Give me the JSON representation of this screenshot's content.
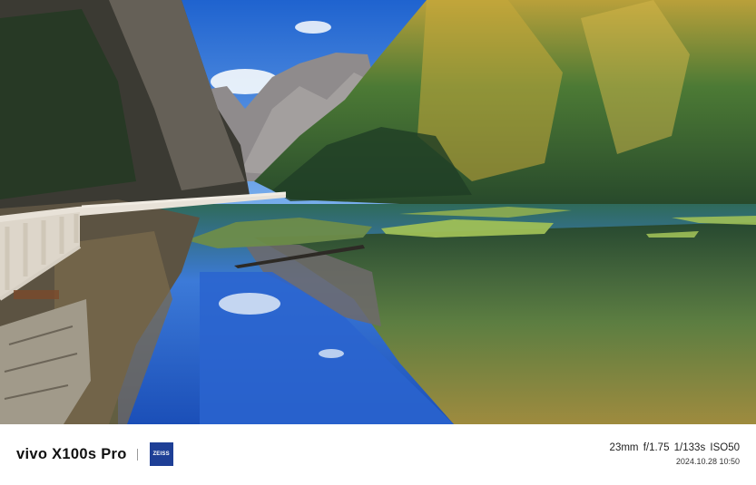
{
  "photo": {
    "subject": "mountain-lake-reflection",
    "colors": {
      "sky": "#2f74d6",
      "water": "#1f5dc4",
      "forest": "#2e5a2c",
      "autumn": "#d9b53a",
      "rock": "#8d8a86"
    }
  },
  "watermark": {
    "brand": "vivo X100s Pro",
    "lens_logo": "ZEISS",
    "settings": "23mm  f/1.75  1/133s  ISO50",
    "datetime": "2024.10.28 10:50"
  }
}
